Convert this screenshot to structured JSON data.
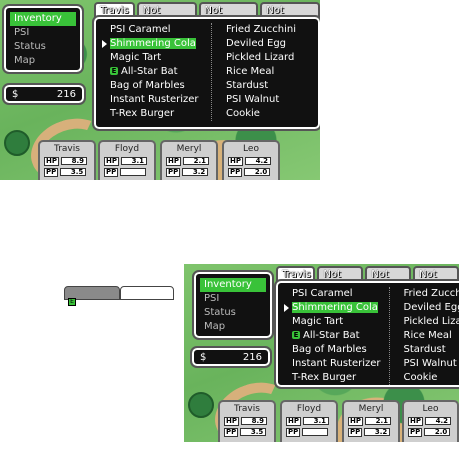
{
  "menu": {
    "items": [
      "Inventory",
      "PSI",
      "Status",
      "Map"
    ],
    "selected": 0
  },
  "money": {
    "symbol": "$",
    "amount": "216"
  },
  "tabs": {
    "labels": [
      "Travis",
      "Not Travis",
      "Not Travis",
      "Not Travis"
    ],
    "active": 0
  },
  "inventory": {
    "left": [
      "PSI Caramel",
      "Shimmering Cola",
      "Magic Tart",
      "All-Star Bat",
      "Bag of Marbles",
      "Instant Rusterizer",
      "T-Rex Burger"
    ],
    "right": [
      "Fried Zucchini",
      "Deviled Egg",
      "Pickled Lizard",
      "Rice Meal",
      "Stardust",
      "PSI Walnut",
      "Cookie"
    ],
    "selected": "Shimmering Cola",
    "equipped_badge": "E",
    "equipped_index": 3
  },
  "party": [
    {
      "name": "Travis",
      "hp": "8.9",
      "pp": "3.5"
    },
    {
      "name": "Floyd",
      "hp": "3.1",
      "pp": ""
    },
    {
      "name": "Meryl",
      "hp": "2.1",
      "pp": "3.2"
    },
    {
      "name": "Leo",
      "hp": "4.2",
      "pp": "2.0"
    }
  ],
  "labels": {
    "hp": "HP",
    "pp": "PP"
  },
  "mini": {
    "badge": "E"
  },
  "colors": {
    "highlight": "#39c239",
    "window": "#111111",
    "status_panel": "#cfcfcf"
  }
}
